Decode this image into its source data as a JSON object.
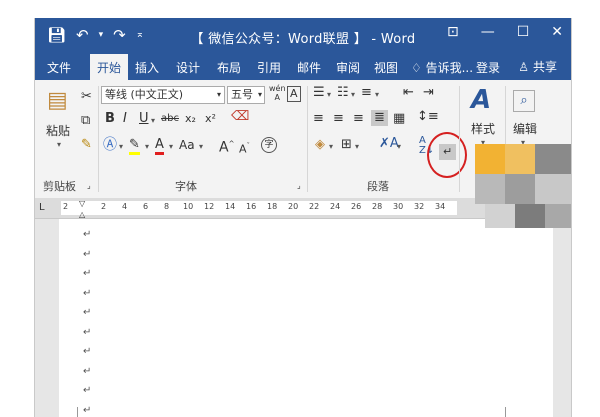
{
  "title_bar": {
    "title": "【 微信公众号：Word联盟 】 - Word",
    "save_icon": "save-icon",
    "undo_icon": "undo-icon",
    "redo_icon": "redo-icon"
  },
  "tabs": {
    "file": "文件",
    "home": "开始",
    "insert": "插入",
    "design": "设计",
    "layout": "布局",
    "references": "引用",
    "mailings": "邮件",
    "review": "审阅",
    "view": "视图",
    "tell_me": "告诉我...",
    "sign_in": "登录",
    "share": "共享"
  },
  "ribbon": {
    "clipboard": {
      "label": "剪贴板",
      "paste": "粘贴"
    },
    "font": {
      "label": "字体",
      "font_name": "等线 (中文正文)",
      "font_size": "五号",
      "bold": "B",
      "italic": "I",
      "underline": "U",
      "strikethrough": "abc",
      "subscript": "x₂",
      "superscript": "x²",
      "change_case": "Aa",
      "grow": "A",
      "shrink": "A",
      "phonetic": "wén",
      "char_border": "A",
      "enclose": "字"
    },
    "paragraph": {
      "label": "段落"
    },
    "styles": {
      "label": "样式"
    },
    "editing": {
      "label": "编辑"
    }
  },
  "ruler": {
    "numbers": [
      "2",
      "2",
      "4",
      "6",
      "8",
      "10",
      "12",
      "14",
      "16",
      "18",
      "20",
      "22",
      "24",
      "26",
      "28",
      "30",
      "32",
      "34"
    ]
  },
  "document": {
    "paragraph_mark": "↵",
    "paragraph_count": 10
  },
  "colors": {
    "title_bar": "#2b579a",
    "ribbon_bg": "#f3f3f3",
    "highlight_circle": "#d52020"
  }
}
